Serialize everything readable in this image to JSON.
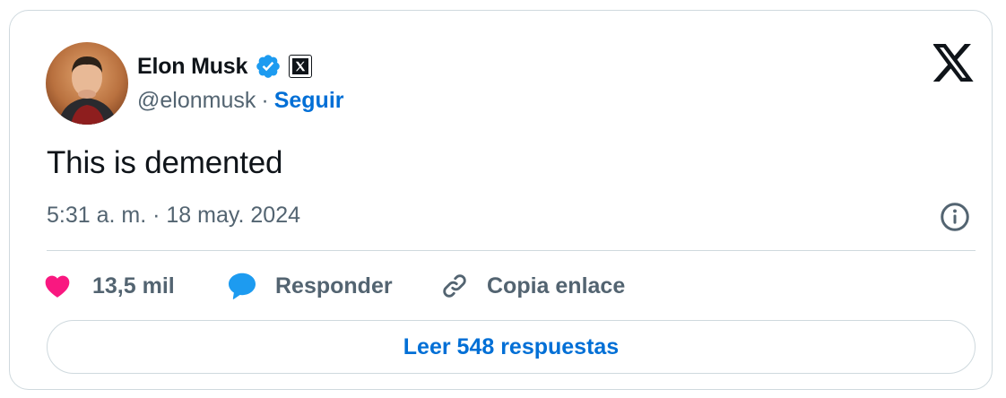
{
  "author": {
    "name": "Elon Musk",
    "handle": "@elonmusk",
    "separator": "·",
    "follow_label": "Seguir"
  },
  "tweet": {
    "text": "This is demented",
    "timestamp": "5:31 a. m. · 18 may. 2024"
  },
  "actions": {
    "like_count": "13,5 mil",
    "reply_label": "Responder",
    "copy_link_label": "Copia enlace"
  },
  "replies_button": "Leer 548 respuestas",
  "icons": {
    "verified": "verified-badge-icon",
    "affiliate": "x-affiliate-icon",
    "brand": "x-logo-icon",
    "info": "info-icon",
    "like": "heart-icon",
    "reply": "speech-bubble-icon",
    "copy": "link-icon"
  },
  "colors": {
    "accent": "#006fd6",
    "verified": "#1d9bf0",
    "like": "#f91880",
    "text": "#0f1419",
    "secondary": "#536471",
    "border": "#cfd9de"
  }
}
